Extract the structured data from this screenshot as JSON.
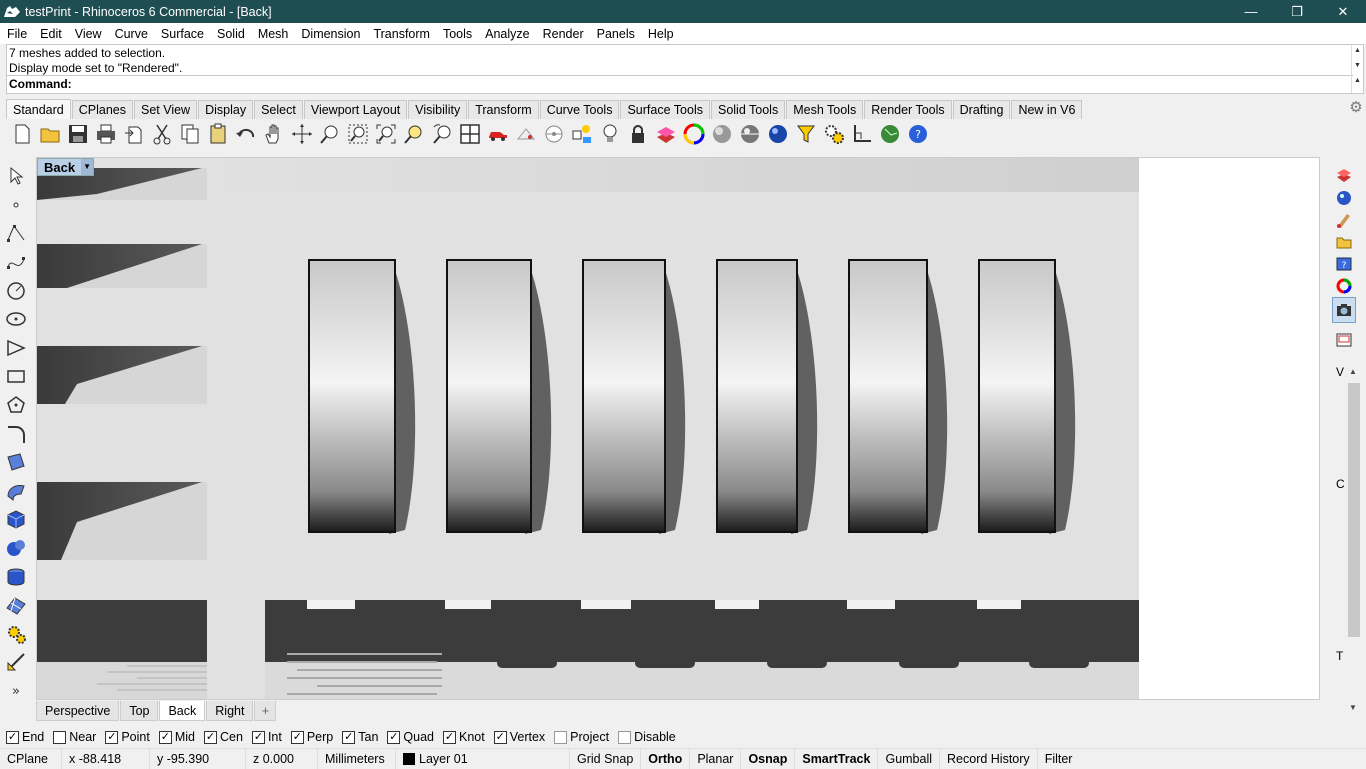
{
  "window": {
    "title": "testPrint - Rhinoceros 6 Commercial - [Back]",
    "minimize": "—",
    "restore": "❐",
    "close": "✕"
  },
  "menu": [
    "File",
    "Edit",
    "View",
    "Curve",
    "Surface",
    "Solid",
    "Mesh",
    "Dimension",
    "Transform",
    "Tools",
    "Analyze",
    "Render",
    "Panels",
    "Help"
  ],
  "command": {
    "history": [
      "7 meshes added to selection.",
      "Display mode set to \"Rendered\"."
    ],
    "label": "Command:",
    "value": ""
  },
  "toolbar_tabs": {
    "active": "Standard",
    "items": [
      "Standard",
      "CPlanes",
      "Set View",
      "Display",
      "Select",
      "Viewport Layout",
      "Visibility",
      "Transform",
      "Curve Tools",
      "Surface Tools",
      "Solid Tools",
      "Mesh Tools",
      "Render Tools",
      "Drafting",
      "New in V6"
    ]
  },
  "toolbar_icons": [
    "new-file-icon",
    "open-file-icon",
    "save-icon",
    "print-icon",
    "import-icon",
    "cut-icon",
    "copy-icon",
    "paste-icon",
    "undo-icon",
    "pan-hand-icon",
    "rotate-view-icon",
    "zoom-dynamic-icon",
    "zoom-window-icon",
    "zoom-extents-icon",
    "zoom-selected-icon",
    "undo-view-icon",
    "four-viewports-icon",
    "car-render-icon",
    "named-view-icon",
    "cplane-icon",
    "object-props-icon",
    "light-bulb-icon",
    "lock-icon",
    "layer-icon",
    "color-wheel-icon",
    "shaded-sphere-icon",
    "rendered-sphere-icon",
    "blue-sphere-icon",
    "select-filter-icon",
    "options-gears-icon",
    "gumball-icon",
    "render-globe-icon",
    "help-icon"
  ],
  "left_tools": [
    "select-arrow-icon",
    "point-icon",
    "polyline-icon",
    "curve-icon",
    "circle-icon",
    "ellipse-icon",
    "arc-icon",
    "rectangle-icon",
    "polygon-icon",
    "fillet-icon",
    "surface-icon",
    "extrude-icon",
    "box-icon",
    "boolean-icon",
    "cylinder-icon",
    "mesh-icon",
    "transform-gears-icon",
    "dimension-icon",
    "more-tools-icon"
  ],
  "viewport": {
    "name": "Back",
    "colors": {
      "background": "#e1e1e1",
      "shadow": "#3c3c3c"
    }
  },
  "viewport_tabs": {
    "active": "Back",
    "items": [
      "Perspective",
      "Top",
      "Back",
      "Right"
    ],
    "add": "+"
  },
  "right_panel_icons": [
    "properties-icon",
    "render-materials-icon",
    "paint-icon",
    "layers-folder-icon",
    "help-panel-icon",
    "color-wheel-icon",
    "camera-icon",
    "capture-icon"
  ],
  "right_panel_letters": [
    "V",
    "C",
    "T"
  ],
  "osnaps": [
    {
      "label": "End",
      "checked": true
    },
    {
      "label": "Near",
      "checked": false
    },
    {
      "label": "Point",
      "checked": true
    },
    {
      "label": "Mid",
      "checked": true
    },
    {
      "label": "Cen",
      "checked": true
    },
    {
      "label": "Int",
      "checked": true
    },
    {
      "label": "Perp",
      "checked": true
    },
    {
      "label": "Tan",
      "checked": true
    },
    {
      "label": "Quad",
      "checked": true
    },
    {
      "label": "Knot",
      "checked": true
    },
    {
      "label": "Vertex",
      "checked": true
    },
    {
      "label": "Project",
      "checked": false
    },
    {
      "label": "Disable",
      "checked": false
    }
  ],
  "status": {
    "cplane": "CPlane",
    "x": "x -88.418",
    "y": "y -95.390",
    "z": "z 0.000",
    "units": "Millimeters",
    "layer": "Layer 01",
    "grid_snap": "Grid Snap",
    "ortho": "Ortho",
    "planar": "Planar",
    "osnap": "Osnap",
    "smarttrack": "SmartTrack",
    "gumball": "Gumball",
    "record_history": "Record History",
    "filter": "Filter"
  }
}
